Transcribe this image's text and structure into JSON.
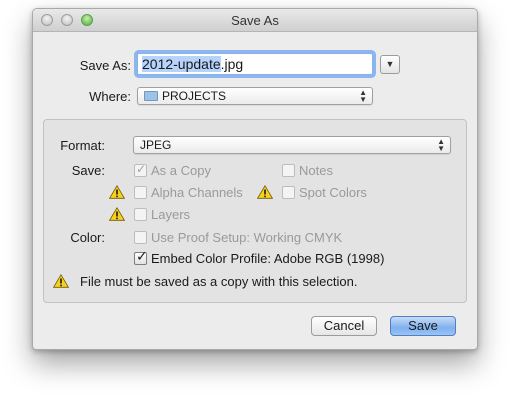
{
  "window": {
    "title": "Save As"
  },
  "save_as": {
    "label": "Save As:",
    "filename_selected": "2012-update",
    "filename_ext": ".jpg"
  },
  "where": {
    "label": "Where:",
    "value": "PROJECTS"
  },
  "format": {
    "label": "Format:",
    "value": "JPEG"
  },
  "save_options": {
    "label": "Save:",
    "as_a_copy": {
      "label": "As a Copy",
      "checked": true,
      "enabled": false
    },
    "notes": {
      "label": "Notes",
      "checked": false,
      "enabled": false
    },
    "alpha_channels": {
      "label": "Alpha Channels",
      "checked": false,
      "enabled": false,
      "warning": true
    },
    "spot_colors": {
      "label": "Spot Colors",
      "checked": false,
      "enabled": false,
      "warning": true
    },
    "layers": {
      "label": "Layers",
      "checked": false,
      "enabled": false,
      "warning": true
    }
  },
  "color": {
    "label": "Color:",
    "use_proof_setup": {
      "label": "Use Proof Setup:  Working CMYK",
      "checked": false,
      "enabled": false
    },
    "embed_color_profile": {
      "label": "Embed Color Profile:  Adobe RGB (1998)",
      "checked": true,
      "enabled": true
    }
  },
  "warning_message": "File must be saved as a copy with this selection.",
  "buttons": {
    "cancel": "Cancel",
    "save": "Save"
  },
  "colors": {
    "accent": "#7fb0ee",
    "warning": "#f6d21f"
  }
}
